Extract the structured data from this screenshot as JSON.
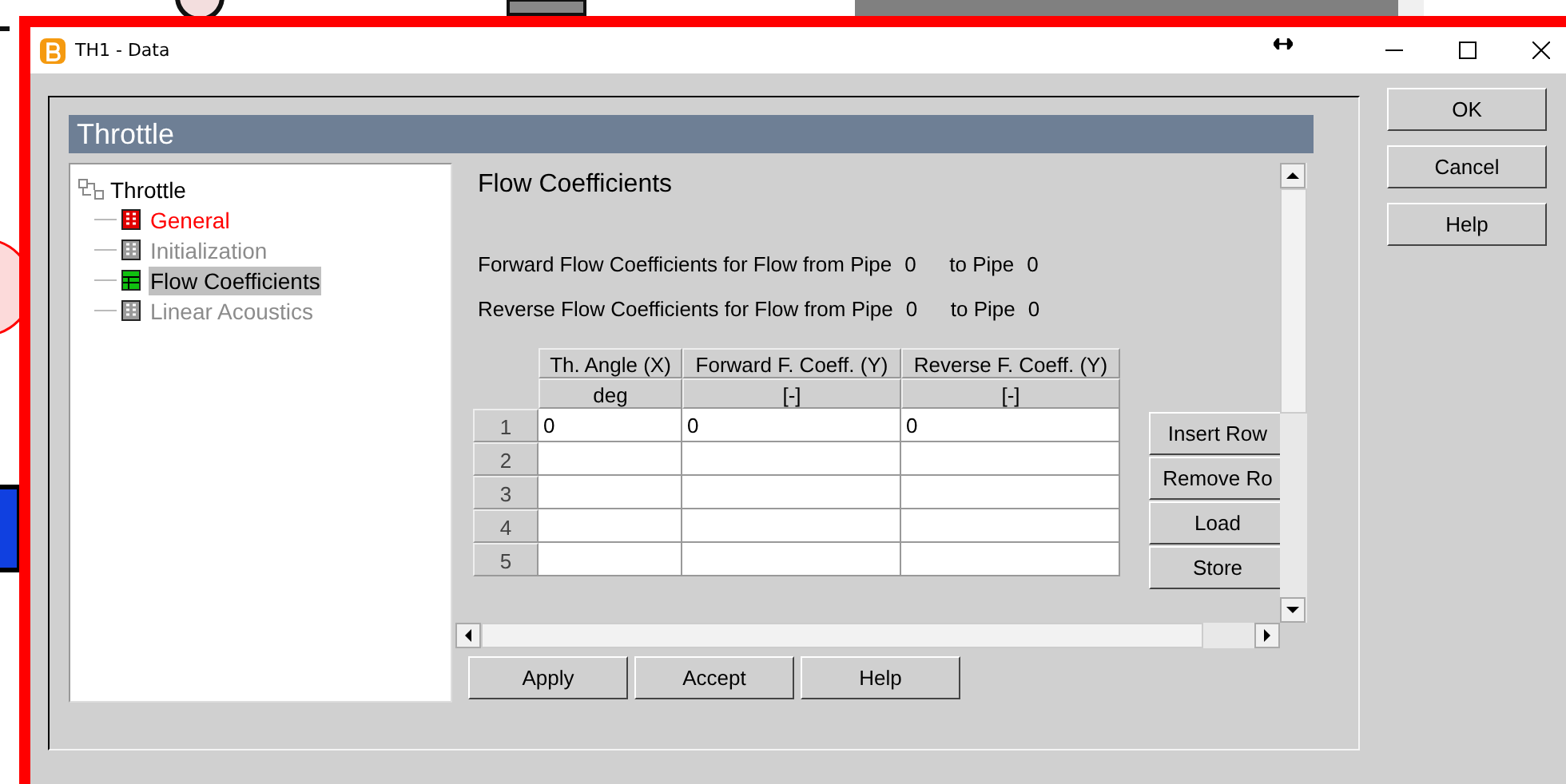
{
  "window": {
    "title": "TH1 - Data"
  },
  "panel": {
    "title": "Throttle"
  },
  "tree": {
    "label": "Throttle",
    "expanded": true,
    "children": [
      {
        "label": "General",
        "kind": "error",
        "selected": false
      },
      {
        "label": "Initialization",
        "kind": "inactive",
        "selected": false
      },
      {
        "label": "Flow Coefficients",
        "kind": "table",
        "selected": true
      },
      {
        "label": "Linear Acoustics",
        "kind": "inactive",
        "selected": false
      }
    ]
  },
  "content": {
    "title": "Flow Coefficients",
    "lines": [
      {
        "label": "Forward Flow Coefficients for Flow from Pipe",
        "from": "0",
        "to_label": "to Pipe",
        "to": "0"
      },
      {
        "label": "Reverse Flow Coefficients for Flow from Pipe",
        "from": "0",
        "to_label": "to Pipe",
        "to": "0"
      }
    ],
    "table": {
      "columns": [
        {
          "name": "Th. Angle (X)",
          "unit": "deg"
        },
        {
          "name": "Forward F. Coeff. (Y)",
          "unit": "[-]"
        },
        {
          "name": "Reverse F. Coeff. (Y)",
          "unit": "[-]"
        }
      ],
      "rows": [
        {
          "number": "1",
          "cells": [
            "0",
            "0",
            "0"
          ]
        },
        {
          "number": "2",
          "cells": []
        },
        {
          "number": "3",
          "cells": []
        },
        {
          "number": "4",
          "cells": []
        },
        {
          "number": "5",
          "cells": []
        }
      ]
    },
    "table_buttons": [
      "Insert Row",
      "Remove Ro",
      "Load",
      "Store"
    ],
    "buttons": [
      "Apply",
      "Accept",
      "Help"
    ]
  },
  "dialog_buttons": [
    "OK",
    "Cancel",
    "Help"
  ]
}
